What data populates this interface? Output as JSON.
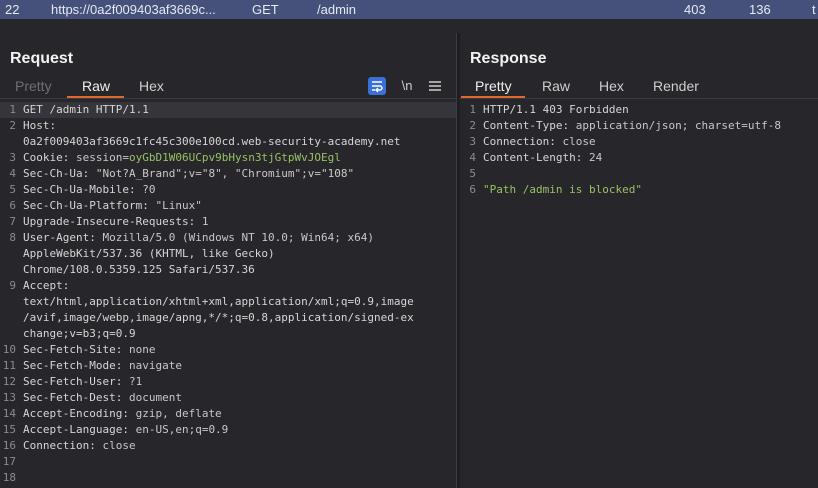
{
  "history_row": {
    "number": "22",
    "url": "https://0a2f009403af3669c...",
    "method": "GET",
    "path": "/admin",
    "status": "403",
    "length": "136",
    "extra": "t"
  },
  "request": {
    "title": "Request",
    "tabs": [
      "Pretty",
      "Raw",
      "Hex"
    ],
    "active_tab": "Raw",
    "toolbar": {
      "wrap_icon": "wrap-lines-icon",
      "newline_label": "\\n",
      "menu_icon": "hamburger-menu-icon"
    },
    "lines": [
      {
        "n": "1",
        "key": "",
        "value": "GET /admin HTTP/1.1"
      },
      {
        "n": "2",
        "key": "Host",
        "value": ""
      },
      {
        "n": "",
        "key": "",
        "value": "0a2f009403af3669c1fc45c300e100cd.web-security-academy.net"
      },
      {
        "n": "3",
        "key": "Cookie",
        "value": " session=",
        "green": "oyGbD1W06UCpv9bHysn3tjGtpWvJOEgl"
      },
      {
        "n": "4",
        "key": "Sec-Ch-Ua",
        "value": " \"Not?A_Brand\";v=\"8\", \"Chromium\";v=\"108\""
      },
      {
        "n": "5",
        "key": "Sec-Ch-Ua-Mobile",
        "value": " ?0"
      },
      {
        "n": "6",
        "key": "Sec-Ch-Ua-Platform",
        "value": " \"Linux\""
      },
      {
        "n": "7",
        "key": "Upgrade-Insecure-Requests",
        "value": " 1"
      },
      {
        "n": "8",
        "key": "User-Agent",
        "value": " Mozilla/5.0 (Windows NT 10.0; Win64; x64)"
      },
      {
        "n": "",
        "key": "",
        "value": "AppleWebKit/537.36 (KHTML, like Gecko)"
      },
      {
        "n": "",
        "key": "",
        "value": "Chrome/108.0.5359.125 Safari/537.36"
      },
      {
        "n": "9",
        "key": "Accept",
        "value": ""
      },
      {
        "n": "",
        "key": "",
        "value": "text/html,application/xhtml+xml,application/xml;q=0.9,image"
      },
      {
        "n": "",
        "key": "",
        "value": "/avif,image/webp,image/apng,*/*;q=0.8,application/signed-ex"
      },
      {
        "n": "",
        "key": "",
        "value": "change;v=b3;q=0.9"
      },
      {
        "n": "10",
        "key": "Sec-Fetch-Site",
        "value": " none"
      },
      {
        "n": "11",
        "key": "Sec-Fetch-Mode",
        "value": " navigate"
      },
      {
        "n": "12",
        "key": "Sec-Fetch-User",
        "value": " ?1"
      },
      {
        "n": "13",
        "key": "Sec-Fetch-Dest",
        "value": " document"
      },
      {
        "n": "14",
        "key": "Accept-Encoding",
        "value": " gzip, deflate"
      },
      {
        "n": "15",
        "key": "Accept-Language",
        "value": " en-US,en;q=0.9"
      },
      {
        "n": "16",
        "key": "Connection",
        "value": " close"
      },
      {
        "n": "17",
        "key": "",
        "value": ""
      },
      {
        "n": "18",
        "key": "",
        "value": ""
      }
    ]
  },
  "response": {
    "title": "Response",
    "tabs": [
      "Pretty",
      "Raw",
      "Hex",
      "Render"
    ],
    "active_tab": "Pretty",
    "lines": [
      {
        "n": "1",
        "key": "",
        "value": "HTTP/1.1 403 Forbidden"
      },
      {
        "n": "2",
        "key": "Content-Type",
        "value": " application/json; charset=utf-8"
      },
      {
        "n": "3",
        "key": "Connection",
        "value": " close"
      },
      {
        "n": "4",
        "key": "Content-Length",
        "value": " 24"
      },
      {
        "n": "5",
        "key": "",
        "value": ""
      },
      {
        "n": "6",
        "key": "",
        "value": "",
        "green": "\"Path /admin is blocked\""
      }
    ]
  },
  "colors": {
    "accent_underline": "#e0692e",
    "string_green": "#98c261",
    "wrap_button": "#3b6fd8"
  }
}
